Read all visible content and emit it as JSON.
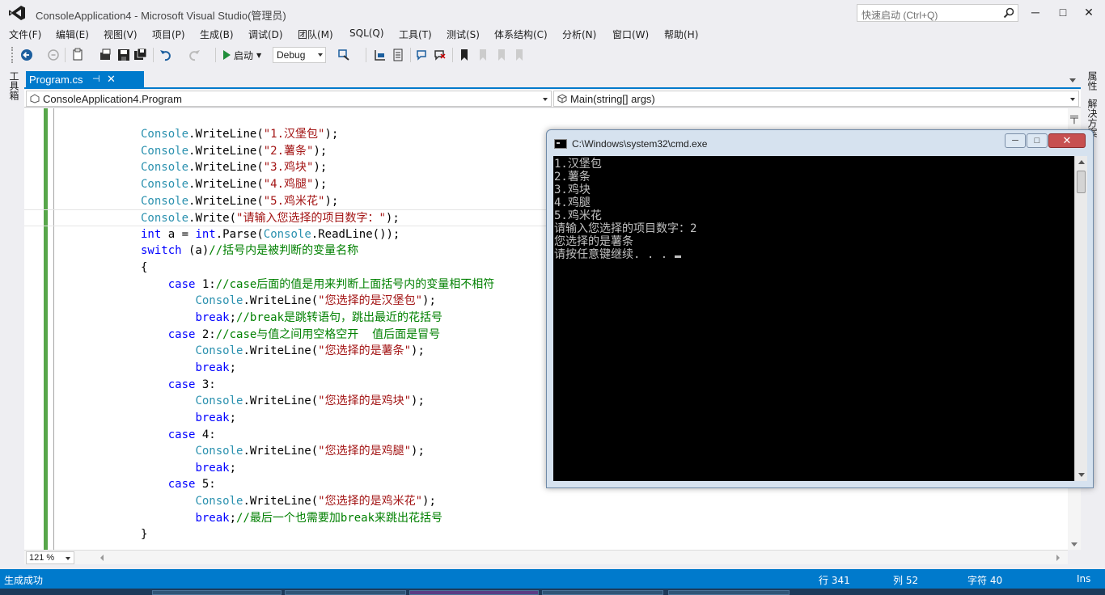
{
  "window": {
    "title": "ConsoleApplication4 - Microsoft Visual Studio(管理员)",
    "quick_launch_placeholder": "快速启动 (Ctrl+Q)",
    "minimize": "─",
    "maximize": "□",
    "close": "✕"
  },
  "menu": [
    "文件(F)",
    "编辑(E)",
    "视图(V)",
    "项目(P)",
    "生成(B)",
    "调试(D)",
    "团队(M)",
    "SQL(Q)",
    "工具(T)",
    "测试(S)",
    "体系结构(C)",
    "分析(N)",
    "窗口(W)",
    "帮助(H)"
  ],
  "toolbar": {
    "start_label": "启动",
    "config": "Debug"
  },
  "left_strip": {
    "toolbox_label": "工具箱"
  },
  "right_strip": {
    "properties_label": "属性",
    "solution_label": "解决方案"
  },
  "doc_tab": {
    "label": "Program.cs",
    "pin": "⊣",
    "close": "✕"
  },
  "navbar": {
    "type_scope": "ConsoleApplication4.Program",
    "member_scope": "Main(string[] args)"
  },
  "code": [
    [
      [
        "type",
        "Console"
      ],
      [
        "plain",
        "."
      ],
      [
        "plain",
        "WriteLine"
      ],
      [
        "plain",
        "("
      ],
      [
        "str",
        "\"1.汉堡包\""
      ],
      [
        "plain",
        ");"
      ]
    ],
    [
      [
        "type",
        "Console"
      ],
      [
        "plain",
        "."
      ],
      [
        "plain",
        "WriteLine"
      ],
      [
        "plain",
        "("
      ],
      [
        "str",
        "\"2.薯条\""
      ],
      [
        "plain",
        ");"
      ]
    ],
    [
      [
        "type",
        "Console"
      ],
      [
        "plain",
        "."
      ],
      [
        "plain",
        "WriteLine"
      ],
      [
        "plain",
        "("
      ],
      [
        "str",
        "\"3.鸡块\""
      ],
      [
        "plain",
        ");"
      ]
    ],
    [
      [
        "type",
        "Console"
      ],
      [
        "plain",
        "."
      ],
      [
        "plain",
        "WriteLine"
      ],
      [
        "plain",
        "("
      ],
      [
        "str",
        "\"4.鸡腿\""
      ],
      [
        "plain",
        ");"
      ]
    ],
    [
      [
        "type",
        "Console"
      ],
      [
        "plain",
        "."
      ],
      [
        "plain",
        "WriteLine"
      ],
      [
        "plain",
        "("
      ],
      [
        "str",
        "\"5.鸡米花\""
      ],
      [
        "plain",
        ");"
      ]
    ],
    [
      [
        "type",
        "Console"
      ],
      [
        "plain",
        "."
      ],
      [
        "plain",
        "Write"
      ],
      [
        "plain",
        "("
      ],
      [
        "str",
        "\"请输入您选择的项目数字：\""
      ],
      [
        "plain",
        ");"
      ]
    ],
    [
      [
        "kw",
        "int"
      ],
      [
        "plain",
        " a = "
      ],
      [
        "kw",
        "int"
      ],
      [
        "plain",
        ".Parse("
      ],
      [
        "type",
        "Console"
      ],
      [
        "plain",
        ".ReadLine());"
      ]
    ],
    [
      [
        "kw",
        "switch"
      ],
      [
        "plain",
        " (a)"
      ],
      [
        "cmt",
        "//括号内是被判断的变量名称"
      ]
    ],
    [
      [
        "plain",
        "{"
      ]
    ],
    [
      [
        "plain",
        "    "
      ],
      [
        "kw",
        "case"
      ],
      [
        "plain",
        " 1:"
      ],
      [
        "cmt",
        "//case后面的值是用来判断上面括号内的变量相不相符"
      ]
    ],
    [
      [
        "plain",
        "        "
      ],
      [
        "type",
        "Console"
      ],
      [
        "plain",
        ".WriteLine("
      ],
      [
        "str",
        "\"您选择的是汉堡包\""
      ],
      [
        "plain",
        ");"
      ]
    ],
    [
      [
        "plain",
        "        "
      ],
      [
        "kw",
        "break"
      ],
      [
        "plain",
        ";"
      ],
      [
        "cmt",
        "//break是跳转语句，跳出最近的花括号"
      ]
    ],
    [
      [
        "plain",
        "    "
      ],
      [
        "kw",
        "case"
      ],
      [
        "plain",
        " 2:"
      ],
      [
        "cmt",
        "//case与值之间用空格空开  值后面是冒号"
      ]
    ],
    [
      [
        "plain",
        "        "
      ],
      [
        "type",
        "Console"
      ],
      [
        "plain",
        ".WriteLine("
      ],
      [
        "str",
        "\"您选择的是薯条\""
      ],
      [
        "plain",
        ");"
      ]
    ],
    [
      [
        "plain",
        "        "
      ],
      [
        "kw",
        "break"
      ],
      [
        "plain",
        ";"
      ]
    ],
    [
      [
        "plain",
        "    "
      ],
      [
        "kw",
        "case"
      ],
      [
        "plain",
        " 3:"
      ]
    ],
    [
      [
        "plain",
        "        "
      ],
      [
        "type",
        "Console"
      ],
      [
        "plain",
        ".WriteLine("
      ],
      [
        "str",
        "\"您选择的是鸡块\""
      ],
      [
        "plain",
        ");"
      ]
    ],
    [
      [
        "plain",
        "        "
      ],
      [
        "kw",
        "break"
      ],
      [
        "plain",
        ";"
      ]
    ],
    [
      [
        "plain",
        "    "
      ],
      [
        "kw",
        "case"
      ],
      [
        "plain",
        " 4:"
      ]
    ],
    [
      [
        "plain",
        "        "
      ],
      [
        "type",
        "Console"
      ],
      [
        "plain",
        ".WriteLine("
      ],
      [
        "str",
        "\"您选择的是鸡腿\""
      ],
      [
        "plain",
        ");"
      ]
    ],
    [
      [
        "plain",
        "        "
      ],
      [
        "kw",
        "break"
      ],
      [
        "plain",
        ";"
      ]
    ],
    [
      [
        "plain",
        "    "
      ],
      [
        "kw",
        "case"
      ],
      [
        "plain",
        " 5:"
      ]
    ],
    [
      [
        "plain",
        "        "
      ],
      [
        "type",
        "Console"
      ],
      [
        "plain",
        ".WriteLine("
      ],
      [
        "str",
        "\"您选择的是鸡米花\""
      ],
      [
        "plain",
        ");"
      ]
    ],
    [
      [
        "plain",
        "        "
      ],
      [
        "kw",
        "break"
      ],
      [
        "plain",
        ";"
      ],
      [
        "cmt",
        "//最后一个也需要加break来跳出花括号"
      ]
    ],
    [
      [
        "plain",
        "}"
      ]
    ]
  ],
  "zoom": "121 %",
  "status": {
    "message": "生成成功",
    "line": "行 341",
    "col": "列 52",
    "char": "字符 40",
    "mode": "Ins"
  },
  "cmd": {
    "title": "C:\\Windows\\system32\\cmd.exe",
    "minimize": "─",
    "maximize": "□",
    "close": "✕",
    "output": [
      "1.汉堡包",
      "2.薯条",
      "3.鸡块",
      "4.鸡腿",
      "5.鸡米花",
      "请输入您选择的项目数字：2",
      "您选择的是薯条",
      "请按任意键继续. . . "
    ]
  },
  "colors": {
    "accent": "#007acc",
    "change_bar": "#57a64a",
    "keyword": "#0000ff",
    "type": "#2b91af",
    "string": "#a31515",
    "comment": "#008000"
  }
}
